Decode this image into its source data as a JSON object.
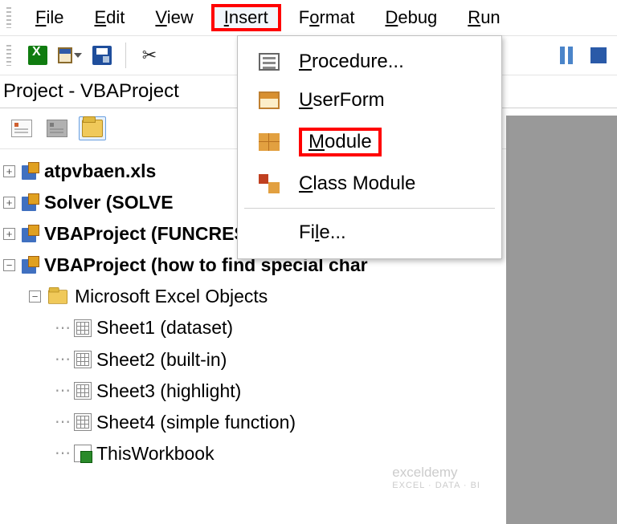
{
  "menubar": {
    "file": "File",
    "edit": "Edit",
    "view": "View",
    "insert": "Insert",
    "format": "Format",
    "debug": "Debug",
    "run": "Run"
  },
  "project_panel": {
    "title": "Project - VBAProject"
  },
  "tree": {
    "n1": "atpvbaen.xls",
    "n2_a": "Solver (SOLVE",
    "n3": "VBAProject (FUNCRES.XLAM)",
    "n4": "VBAProject (how to find special char",
    "folder": "Microsoft Excel Objects",
    "s1": "Sheet1 (dataset)",
    "s2": "Sheet2 (built-in)",
    "s3": "Sheet3 (highlight)",
    "s4": "Sheet4 (simple function)",
    "wb": "ThisWorkbook"
  },
  "insert_menu": {
    "procedure": "Procedure...",
    "userform": "UserForm",
    "module": "Module",
    "class_module": "Class Module",
    "file": "File..."
  },
  "watermark": {
    "brand": "exceldemy",
    "tag": "EXCEL · DATA · BI"
  }
}
